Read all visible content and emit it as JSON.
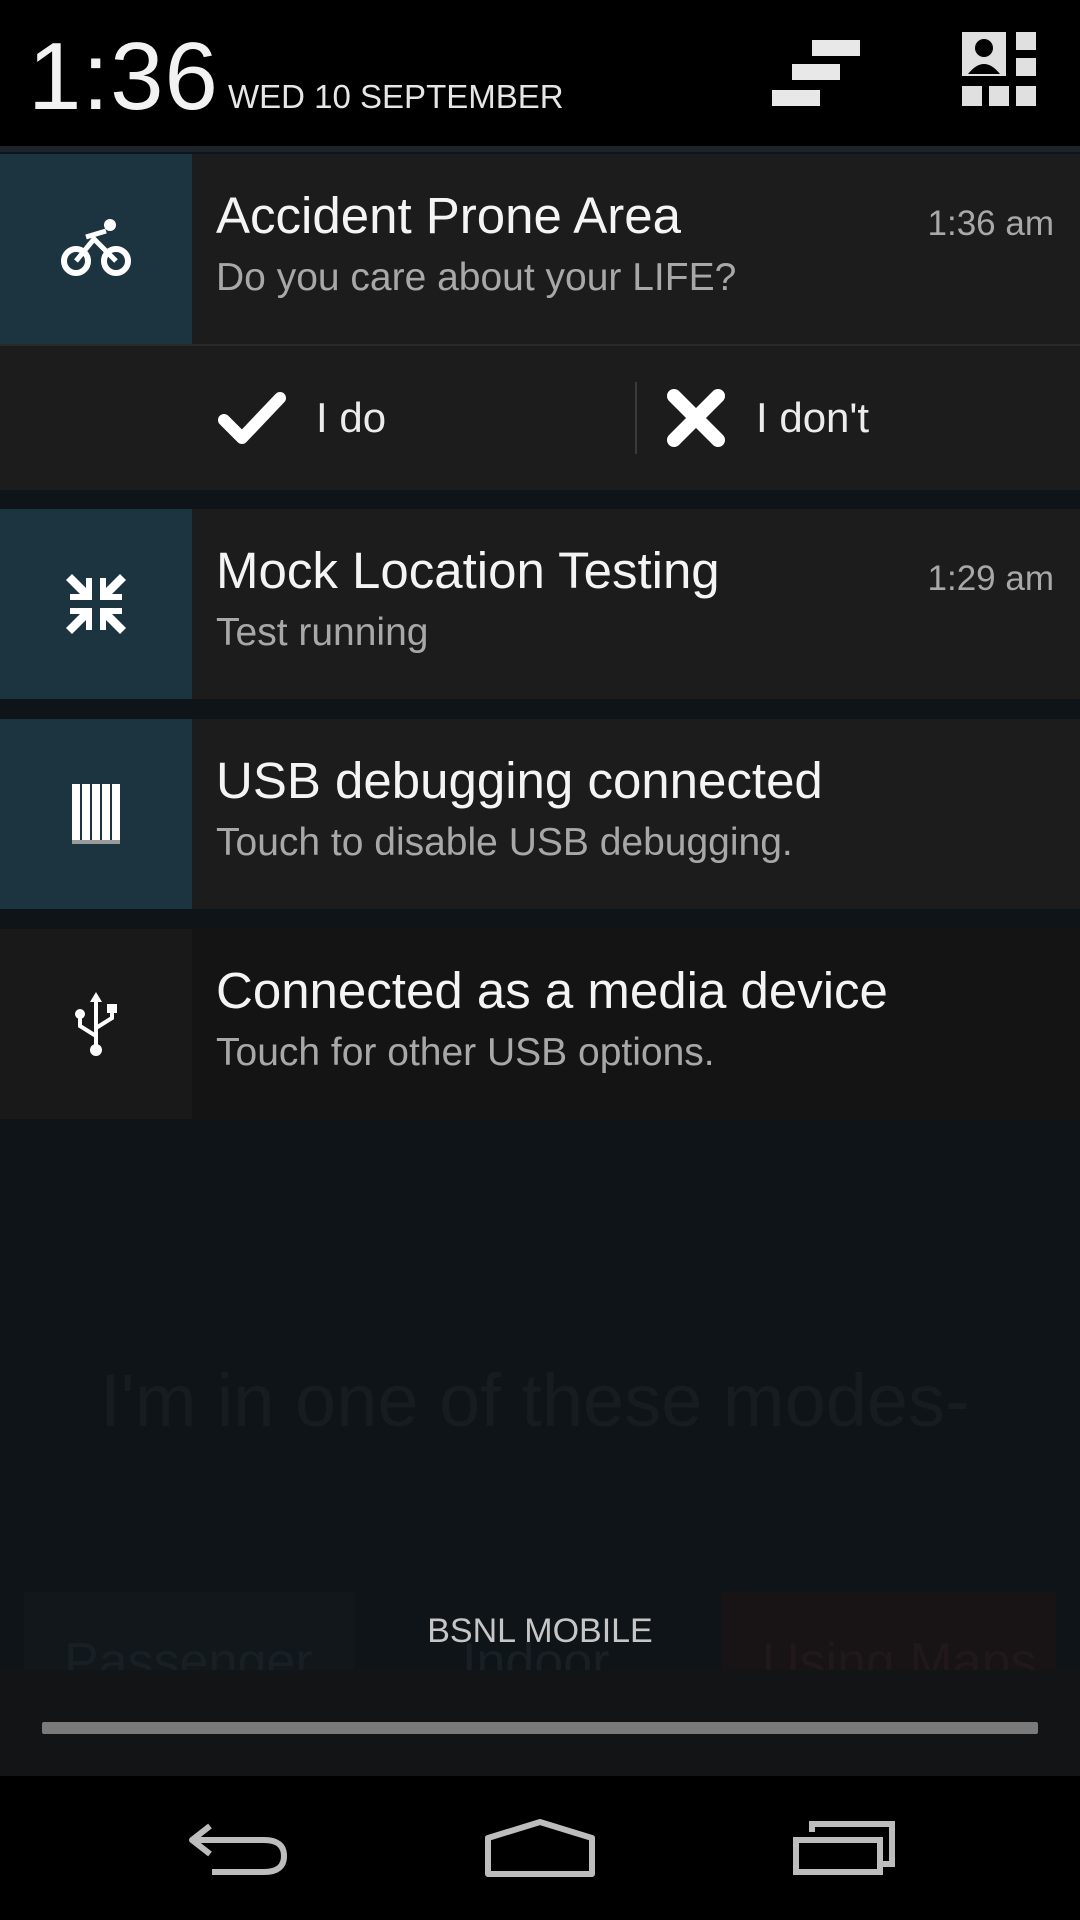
{
  "header": {
    "clock": "1:36",
    "date": "WED 10 SEPTEMBER"
  },
  "notifications": [
    {
      "icon": "bike-icon",
      "title": "Accident Prone Area",
      "text": "Do you care about your LIFE?",
      "time": "1:36 am",
      "actions": [
        {
          "icon": "check-icon",
          "label": "I do"
        },
        {
          "icon": "x-icon",
          "label": "I don't"
        }
      ]
    },
    {
      "icon": "collapse-arrows-icon",
      "title": "Mock Location Testing",
      "text": "Test running",
      "time": "1:29 am"
    },
    {
      "icon": "usb-debug-icon",
      "title": "USB debugging connected",
      "text": "Touch to disable USB debugging."
    },
    {
      "icon": "usb-icon",
      "title": "Connected as a media device",
      "text": "Touch for other USB options."
    }
  ],
  "background_app": {
    "text": "I'm in one of these modes-",
    "modes": [
      "Passenger",
      "Indoor",
      "Using Maps"
    ]
  },
  "carrier": "BSNL MOBILE",
  "colors": {
    "icon_box": "#1c3440",
    "card": "#1c1c1c",
    "background": "#0f1418"
  }
}
